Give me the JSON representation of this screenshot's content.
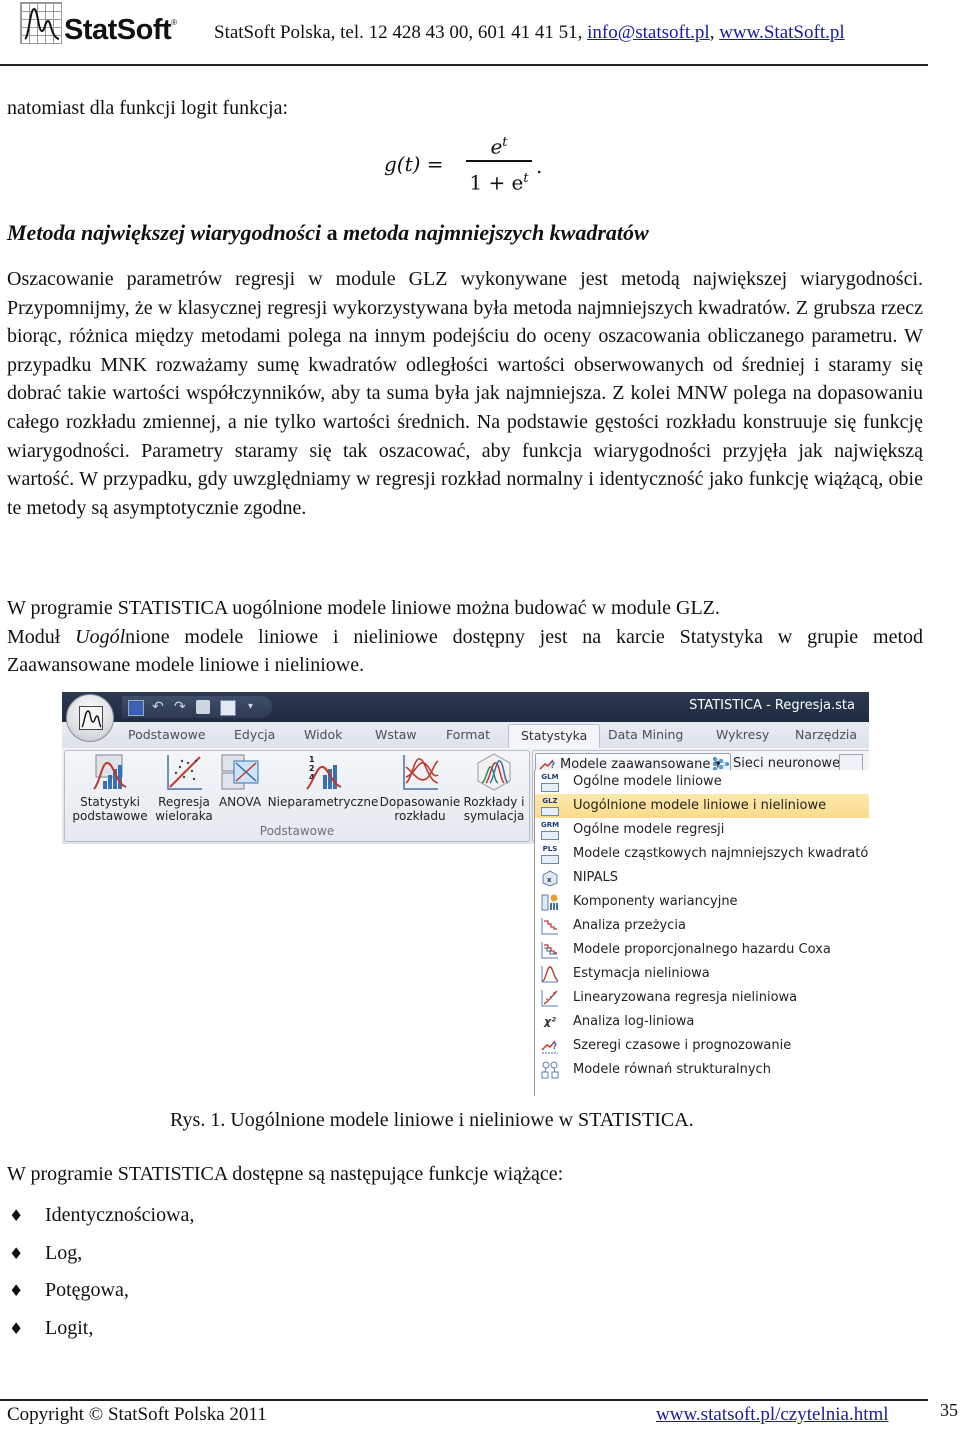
{
  "header": {
    "logo_text": "StatSoft",
    "logo_reg": "®",
    "contact_prefix": "StatSoft Polska, tel. 12 428 43 00, 601 41 41 51, ",
    "email": "info@statsoft.pl",
    "separator": ", ",
    "website": "www.StatSoft.pl"
  },
  "intro": "natomiast dla funkcji logit funkcja:",
  "formula": {
    "lhs": "g(t) =",
    "numerator_base": "e",
    "numerator_exp": "t",
    "denominator_prefix": "1 + e",
    "denominator_exp": "t",
    "terminator": "."
  },
  "section": {
    "title_part1": "Metoda największej wiarygodności",
    "title_conj": " a ",
    "title_part2": "metoda najmniejszych kwadratów"
  },
  "paragraph1": "Oszacowanie parametrów regresji w module GLZ wykonywane jest metodą największej wiarygodności. Przypomnijmy, że w klasycznej regresji wykorzystywana była metoda najmniejszych kwadratów. Z grubsza rzecz biorąc, różnica między metodami polega na innym podejściu do oceny oszacowania obliczanego parametru. W przypadku MNK rozważamy sumę kwadratów odległości wartości obserwowanych od średniej i staramy się dobrać takie wartości współczynników, aby ta suma była jak najmniejsza. Z kolei MNW polega na dopasowaniu całego rozkładu zmiennej, a nie tylko wartości średnich. Na podstawie gęstości rozkładu konstruuje się funkcję wiarygodności. Parametry staramy się tak oszacować, aby funkcja wiarygodności przyjęła jak największą wartość. W przypadku, gdy uwzględniamy w regresji rozkład normalny i identyczność jako funkcję wiążącą, obie te metody są asymptotycznie zgodne.",
  "paragraph2": {
    "line1": "W programie STATISTICA uogólnione modele liniowe można budować w module GLZ.",
    "modul": "Moduł ",
    "italic": "Uogól",
    "rest": "nione modele liniowe i nieliniowe dostępny jest na karcie Statystyka w grupie metod Zaawansowane modele liniowe i nieliniowe."
  },
  "figure": {
    "window_title": "STATISTICA - Regresja.sta",
    "quick_access": [
      "save-icon",
      "undo-icon",
      "redo-icon",
      "print-icon",
      "layout-icon",
      "customize-icon"
    ],
    "tabs": [
      {
        "label": "Podstawowe",
        "active": false
      },
      {
        "label": "Edycja",
        "active": false
      },
      {
        "label": "Widok",
        "active": false
      },
      {
        "label": "Wstaw",
        "active": false
      },
      {
        "label": "Format",
        "active": false
      },
      {
        "label": "Statystyka",
        "active": true
      },
      {
        "label": "Data Mining",
        "active": false
      },
      {
        "label": "Wykresy",
        "active": false
      },
      {
        "label": "Narzędzia",
        "active": false
      }
    ],
    "group_basic": {
      "label": "Podstawowe",
      "buttons": [
        {
          "line1": "Statystyki",
          "line2": "podstawowe",
          "icon": "basic-statistics-icon"
        },
        {
          "line1": "Regresja",
          "line2": "wieloraka",
          "icon": "multiple-regression-icon"
        },
        {
          "line1": "ANOVA",
          "line2": "",
          "icon": "anova-icon"
        },
        {
          "line1": "Nieparametryczne",
          "line2": "",
          "icon": "nonparametric-icon"
        },
        {
          "line1": "Dopasowanie",
          "line2": "rozkładu",
          "icon": "distribution-fitting-icon"
        },
        {
          "line1": "Rozkłady i",
          "line2": "symulacja",
          "icon": "distributions-simulation-icon"
        }
      ]
    },
    "advanced_button": "Modele zaawansowane",
    "dropdown_arrow": "▾",
    "neural_button": "Sieci neuronowe",
    "menu_items": [
      {
        "label": "Ogólne modele liniowe",
        "badge": "GLM",
        "highlight": false
      },
      {
        "label": "Uogólnione modele liniowe i nieliniowe",
        "badge": "GLZ",
        "highlight": true
      },
      {
        "label": "Ogólne modele regresji",
        "badge": "GRM",
        "highlight": false
      },
      {
        "label": "Modele cząstkowych najmniejszych kwadratów",
        "badge": "PLS",
        "highlight": false
      },
      {
        "label": "NIPALS",
        "badge": "",
        "highlight": false
      },
      {
        "label": "Komponenty wariancyjne",
        "badge": "",
        "highlight": false
      },
      {
        "label": "Analiza przeżycia",
        "badge": "",
        "highlight": false
      },
      {
        "label": "Modele proporcjonalnego hazardu Coxa",
        "badge": "",
        "highlight": false
      },
      {
        "label": "Estymacja nieliniowa",
        "badge": "",
        "highlight": false
      },
      {
        "label": "Linearyzowana regresja nieliniowa",
        "badge": "",
        "highlight": false
      },
      {
        "label": "Analiza log-liniowa",
        "badge": "χ²",
        "highlight": false
      },
      {
        "label": "Szeregi czasowe i prognozowanie",
        "badge": "",
        "highlight": false
      },
      {
        "label": "Modele równań strukturalnych",
        "badge": "",
        "highlight": false
      }
    ],
    "colors": {
      "highlight": "#fbdb8c",
      "titlebar": "#243149",
      "accent_red": "#c0392b",
      "accent_blue": "#3a6fb0"
    }
  },
  "caption": "Rys. 1. Uogólnione modele liniowe i nieliniowe w STATISTICA.",
  "list_intro": "W programie STATISTICA dostępne są następujące funkcje wiążące:",
  "bullet_glyph": "♦",
  "link_functions": [
    "Identycznościowa,",
    "Log,",
    "Potęgowa,",
    "Logit,"
  ],
  "footer": {
    "copyright": "Copyright © StatSoft Polska 2011",
    "link": "www.statsoft.pl/czytelnia.html",
    "page_number": "35"
  }
}
